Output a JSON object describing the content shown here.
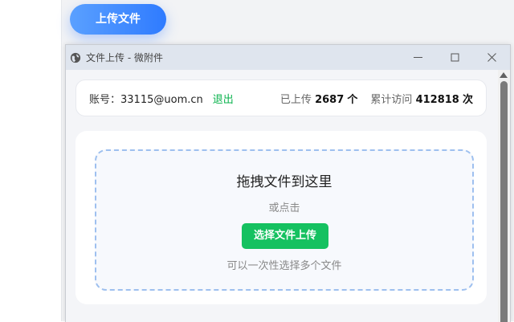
{
  "top_button": {
    "label": "上传文件"
  },
  "window": {
    "title": "文件上传 - 微附件",
    "icons": {
      "app": "globe-icon",
      "minimize": "minimize-icon",
      "maximize": "maximize-icon",
      "close": "close-icon"
    }
  },
  "account": {
    "label": "账号：",
    "email": "33115@uom.cn",
    "logout_label": "退出"
  },
  "stats": {
    "uploaded_label": "已上传",
    "uploaded_count": "2687",
    "uploaded_unit": "个",
    "visits_label": "累计访问",
    "visits_count": "412818",
    "visits_unit": "次"
  },
  "dropzone": {
    "title": "拖拽文件到这里",
    "or_text": "或点击",
    "button_label": "选择文件上传",
    "hint": "可以一次性选择多个文件"
  },
  "colors": {
    "accent_blue": "#2f7bff",
    "success_green": "#15c160",
    "logout_green": "#0bb34e",
    "dashed_border": "#9ec0ef"
  }
}
